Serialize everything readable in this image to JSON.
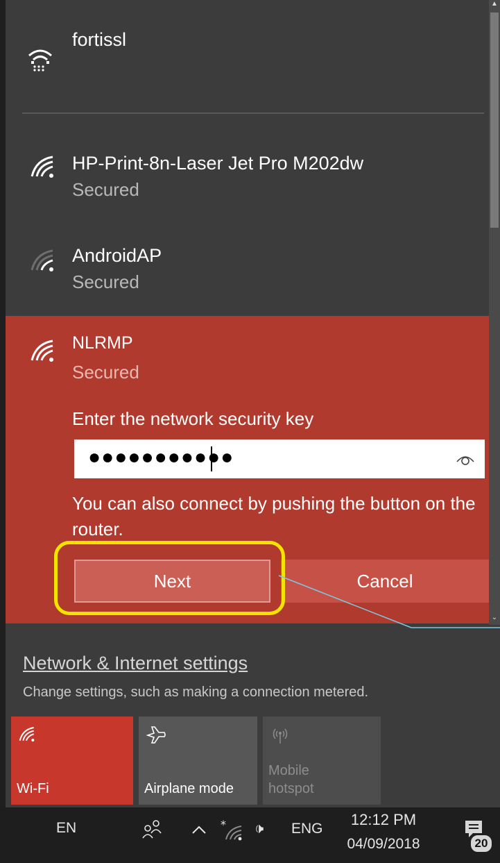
{
  "networks": [
    {
      "name": "fortissl",
      "status": ""
    },
    {
      "name": "HP-Print-8n-Laser Jet Pro M202dw",
      "status": "Secured"
    },
    {
      "name": "AndroidAP",
      "status": "Secured"
    }
  ],
  "selected_network": {
    "name": "NLRMP",
    "status": "Secured",
    "key_label": "Enter the network security key",
    "key_value": "●●●●●●●●●●●",
    "wps_text": "You can also connect by pushing the button on the router.",
    "next_label": "Next",
    "cancel_label": "Cancel"
  },
  "settings": {
    "link": "Network & Internet settings",
    "description": "Change settings, such as making a connection metered."
  },
  "quick_actions": [
    {
      "label": "Wi-Fi",
      "icon": "wifi-icon",
      "active": true
    },
    {
      "label": "Airplane mode",
      "icon": "airplane-icon",
      "active": false
    },
    {
      "label": "Mobile hotspot",
      "icon": "hotspot-icon",
      "active": false
    }
  ],
  "taskbar": {
    "input_lang": "EN",
    "keyboard_lang": "ENG",
    "time": "12:12 PM",
    "date": "04/09/2018",
    "notification_count": "20"
  },
  "colors": {
    "panel_bg": "#3c3c3c",
    "accent": "#b13a2f",
    "highlight": "#f4e300",
    "callout_line": "#7ec8e3"
  }
}
